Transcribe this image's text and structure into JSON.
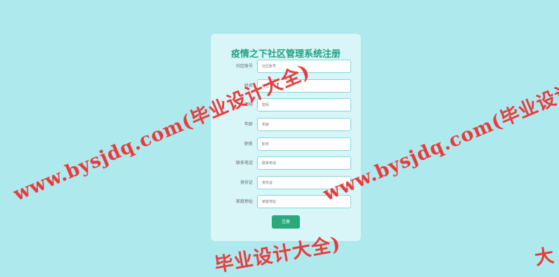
{
  "form": {
    "title": "疫情之下社区管理系统注册",
    "fields": [
      {
        "label": "社区账号",
        "placeholder": "社区账号"
      },
      {
        "label": "姓名",
        "placeholder": "姓名"
      },
      {
        "label": "密码",
        "placeholder": "密码"
      },
      {
        "label": "年龄",
        "placeholder": "年龄"
      },
      {
        "label": "职务",
        "placeholder": "职务"
      },
      {
        "label": "联系电话",
        "placeholder": "联系电话"
      },
      {
        "label": "身份证",
        "placeholder": "身份证"
      },
      {
        "label": "家庭地址",
        "placeholder": "家庭地址"
      }
    ],
    "submit_label": "注册"
  },
  "watermark": {
    "text_a": "www.bysjdq.com(毕业设计大全)",
    "text_b": "www.bysjdq.com(毕业设计大全)",
    "text_c": "毕业设计大全)",
    "text_d": "大"
  },
  "colors": {
    "background": "#aee9ee",
    "card": "#d8f5f8",
    "accent": "#1fa27d",
    "button": "#2aa97b",
    "watermark": "#e83c3c"
  },
  "icons": {
    "cursor": "text-cursor-icon"
  }
}
